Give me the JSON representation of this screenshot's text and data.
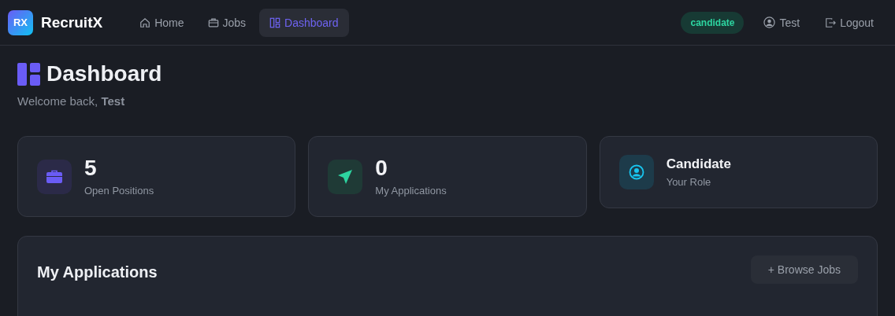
{
  "brand": {
    "logo": "RX",
    "name": "RecruitX"
  },
  "nav": [
    {
      "label": "Home",
      "selected": false
    },
    {
      "label": "Jobs",
      "selected": false
    },
    {
      "label": "Dashboard",
      "selected": true
    }
  ],
  "user": {
    "role_badge": "candidate",
    "name": "Test",
    "logout": "Logout"
  },
  "page": {
    "title": "Dashboard",
    "welcome": "Welcome back, **Test**"
  },
  "stats": [
    {
      "kind": "number",
      "value": "5",
      "label": "Open Positions"
    },
    {
      "kind": "number",
      "value": "0",
      "label": "My Applications"
    },
    {
      "kind": "text",
      "value": "Candidate",
      "label": "Your Role"
    }
  ],
  "applications": {
    "title": "My Applications",
    "button": "+ Browse Jobs"
  }
}
